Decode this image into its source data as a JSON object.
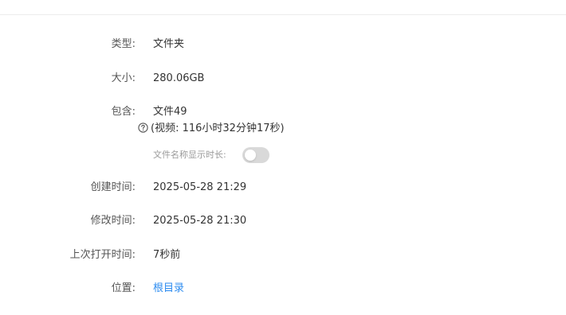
{
  "properties": {
    "type": {
      "label": "类型:",
      "value": "文件夹"
    },
    "size": {
      "label": "大小:",
      "value": "280.06GB"
    },
    "contains": {
      "label": "包含:",
      "value": "文件49",
      "video_note": "(视频: 116小时32分钟17秒)"
    },
    "duration_toggle": {
      "label": "文件名称显示时长:",
      "enabled": false
    },
    "created": {
      "label": "创建时间:",
      "value": "2025-05-28 21:29"
    },
    "modified": {
      "label": "修改时间:",
      "value": "2025-05-28 21:30"
    },
    "last_opened": {
      "label": "上次打开时间:",
      "value": "7秒前"
    },
    "location": {
      "label": "位置:",
      "value": "根目录"
    }
  },
  "colors": {
    "link": "#2d8cf0",
    "toggle_off": "#d9d9d9"
  },
  "icons": {
    "help": "question-circle-icon"
  }
}
